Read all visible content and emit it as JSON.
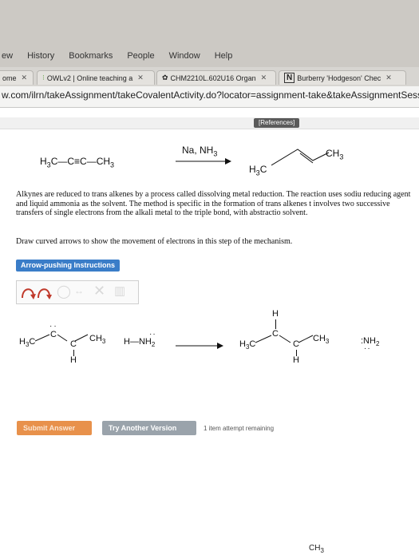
{
  "menu": [
    "ew",
    "History",
    "Bookmarks",
    "People",
    "Window",
    "Help"
  ],
  "tabs": [
    {
      "label": "ome"
    },
    {
      "label": "OWLv2 | Online teaching a"
    },
    {
      "label": "CHM2210L.602U16 Organ"
    },
    {
      "label": "Burberry 'Hodgeson' Chec"
    }
  ],
  "url": "w.com/ilrn/takeAssignment/takeCovalentActivity.do?locator=assignment-take&takeAssignmentSession",
  "references_label": "[References]",
  "reaction": {
    "reactant": "H3C—C≡C—CH3",
    "reagents": "Na, NH3",
    "product_h3c": "H3C",
    "product_ch3": "CH3"
  },
  "paragraphs": {
    "p1": "Alkynes are reduced to trans alkenes by a process called dissolving metal reduction. The reaction uses sodiu reducing agent and liquid ammonia as the solvent. The method is specific in the formation of trans alkenes t involves two successive transfers of single electrons from the alkali metal to the triple bond, with abstractio solvent.",
    "p2": "Draw curved arrows to show the movement of electrons in this step of the mechanism."
  },
  "arrow_instructions_label": "Arrow-pushing Instructions",
  "mechanism": {
    "left_h3c": "H3C",
    "left_c1": "C",
    "left_c2": "C",
    "left_ch3": "CH3",
    "left_h": "H",
    "nh2_reagent": "H—NH2",
    "right_h_top": "H",
    "right_h3c": "H3C",
    "right_c1": "C",
    "right_c2": "C",
    "right_ch3": "CH3",
    "right_h": "H",
    "nh2_product": ":NH2"
  },
  "buttons": {
    "submit": "Submit Answer",
    "another": "Try Another Version"
  },
  "attempt_text": "1 item attempt remaining",
  "bottom_label": "CH3",
  "colors": {
    "accent": "#3a7dc8",
    "submit": "#e8914b",
    "secondary": "#9aa3ab"
  }
}
